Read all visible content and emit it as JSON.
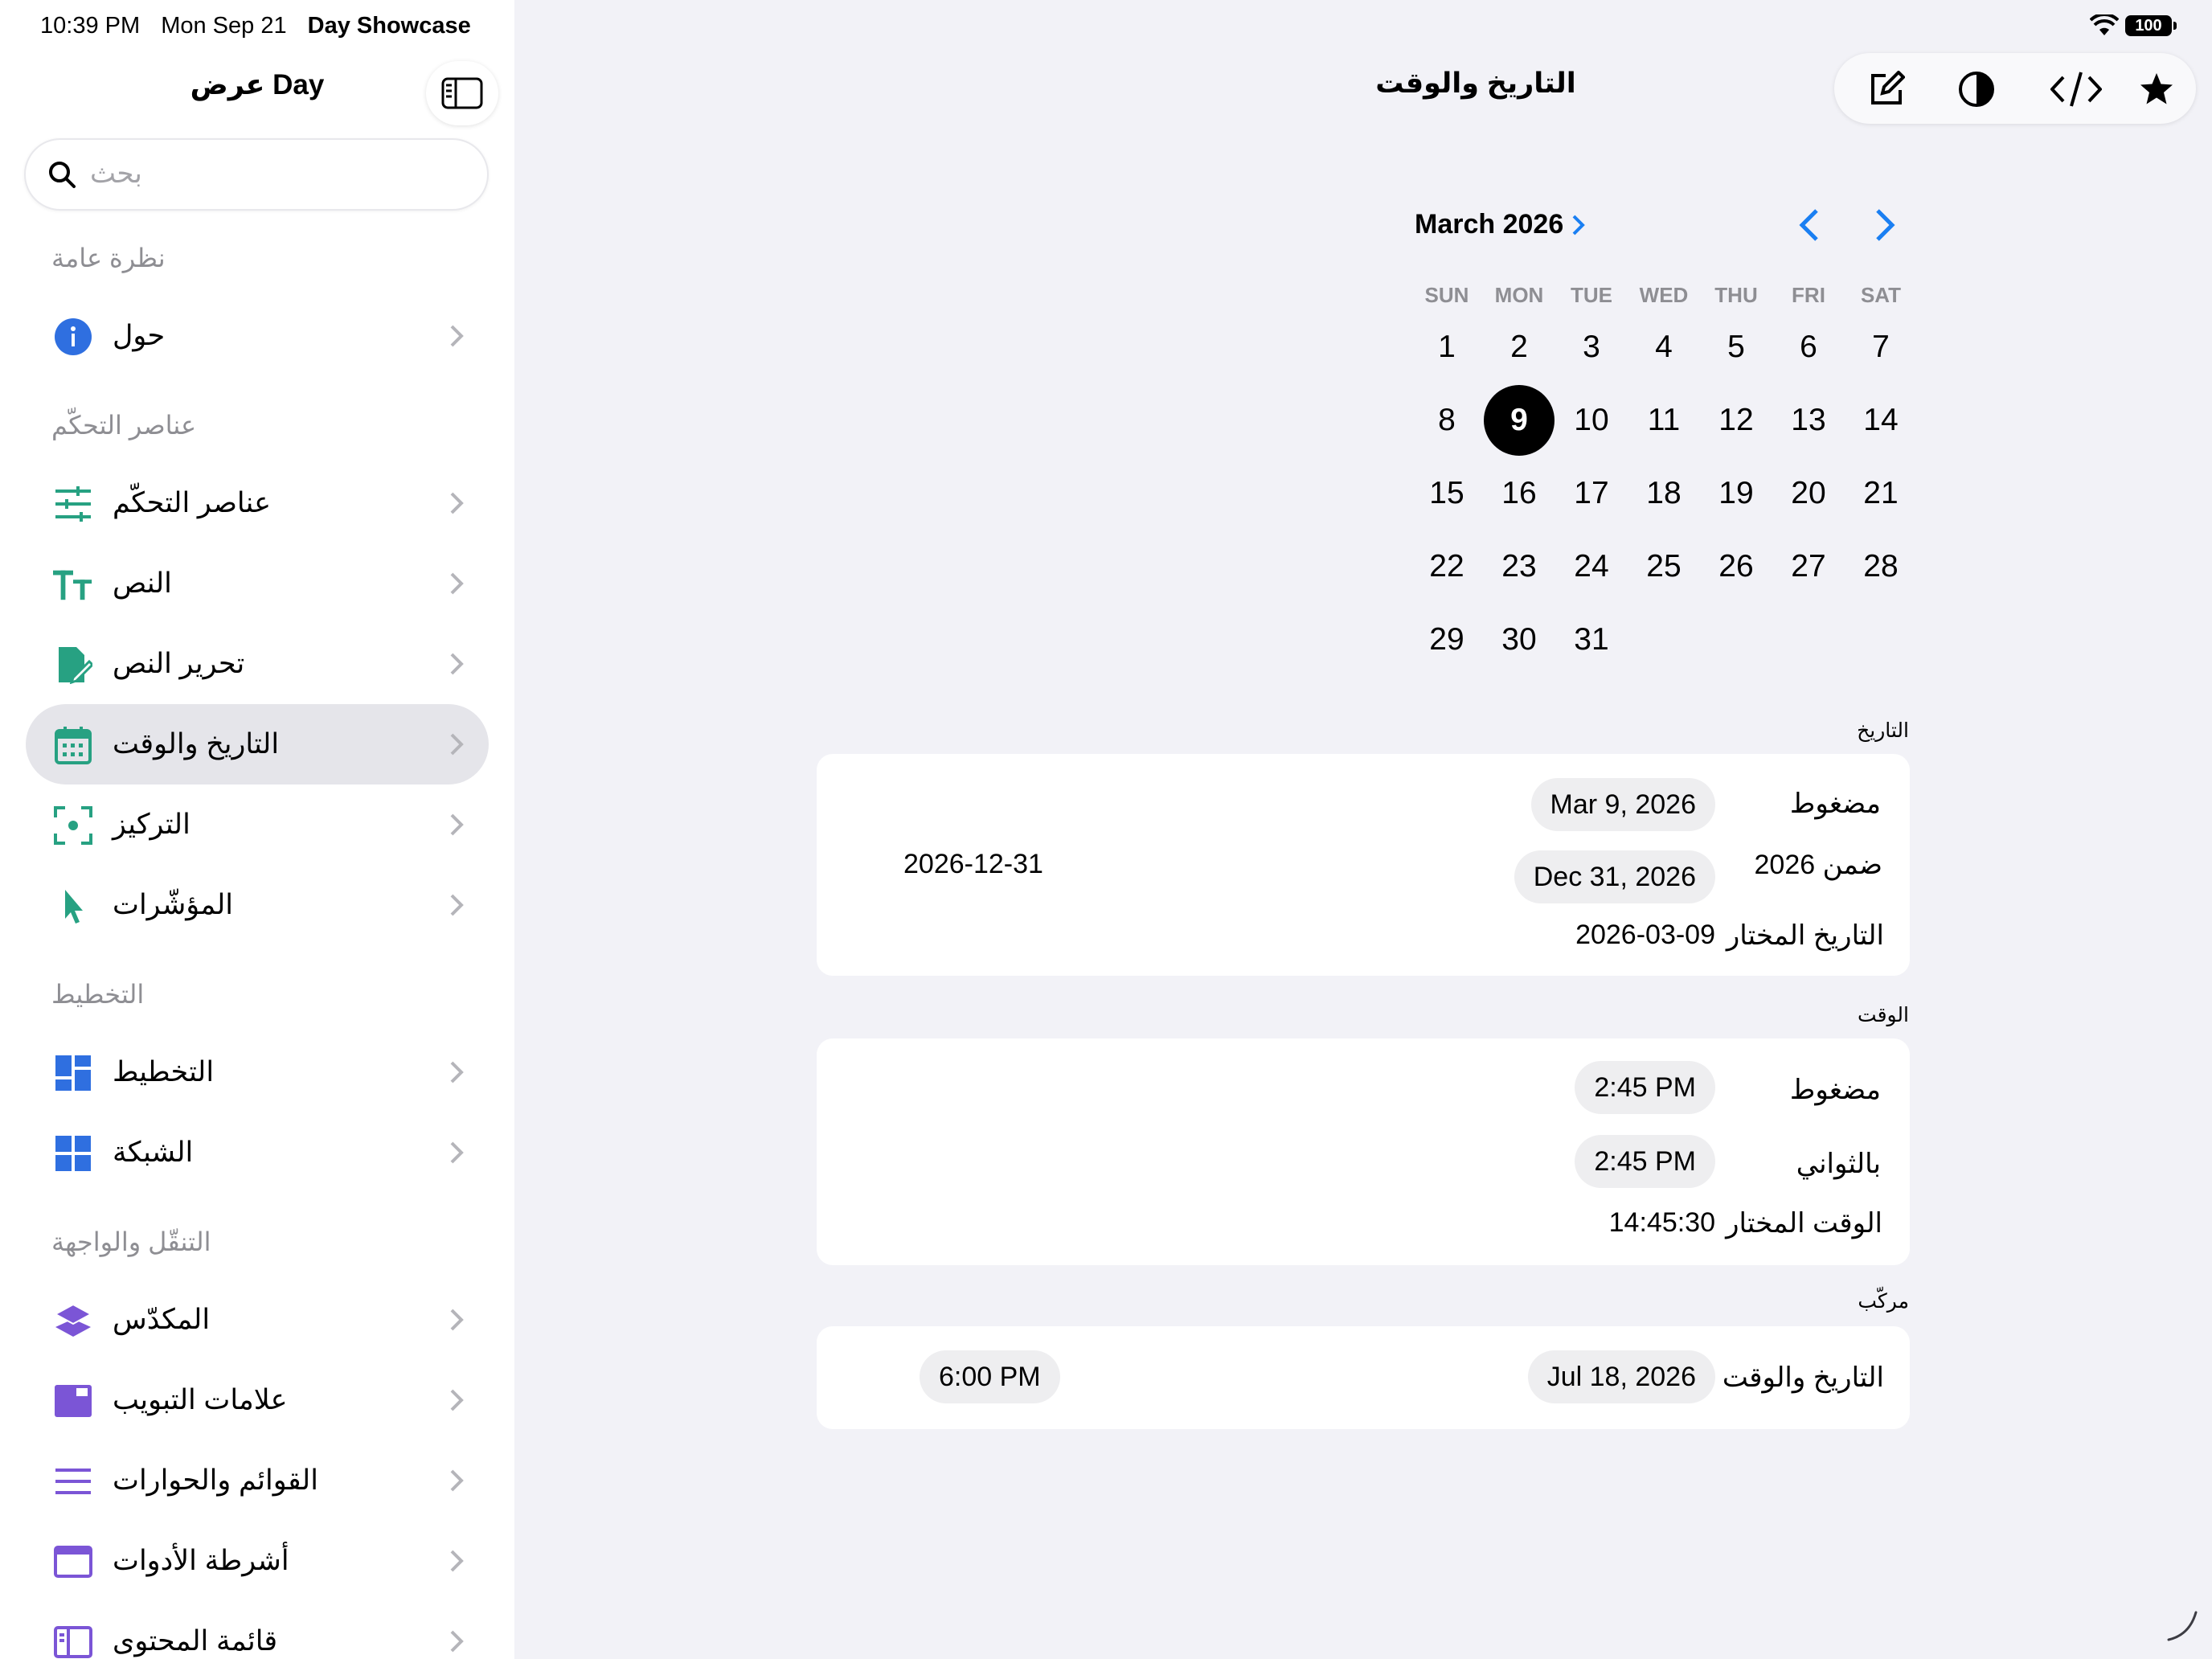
{
  "status": {
    "time": "10:39 PM",
    "date": "Mon Sep 21",
    "app": "Day Showcase",
    "battery": "100"
  },
  "sidebar": {
    "title": "عرض Day",
    "search_placeholder": "بحث",
    "sections": {
      "overview": "نظرة عامة",
      "controls": "عناصر التحكّم",
      "layout": "التخطيط",
      "navigation": "التنقّل والواجهة"
    },
    "items": [
      {
        "label": "حول",
        "icon": "info-icon"
      },
      {
        "label": "عناصر التحكّم",
        "icon": "sliders-icon"
      },
      {
        "label": "النص",
        "icon": "text-format-icon"
      },
      {
        "label": "تحرير النص",
        "icon": "doc-edit-icon"
      },
      {
        "label": "التاريخ والوقت",
        "icon": "calendar-icon"
      },
      {
        "label": "التركيز",
        "icon": "focus-icon"
      },
      {
        "label": "المؤشّرات",
        "icon": "pointer-icon"
      },
      {
        "label": "التخطيط",
        "icon": "layout-icon"
      },
      {
        "label": "الشبكة",
        "icon": "grid-icon"
      },
      {
        "label": "المكدّس",
        "icon": "stack-icon"
      },
      {
        "label": "علامات التبويب",
        "icon": "tabs-icon"
      },
      {
        "label": "القوائم والحوارات",
        "icon": "list-icon"
      },
      {
        "label": "أشرطة الأدوات",
        "icon": "toolbar-icon"
      },
      {
        "label": "قائمة المحتوى",
        "icon": "sidebar-list-icon"
      }
    ],
    "selected_item": "التاريخ والوقت"
  },
  "main": {
    "title": "التاريخ والوقت",
    "toolbar": [
      "edit-icon",
      "contrast-icon",
      "code-icon",
      "star-icon"
    ],
    "calendar": {
      "month_label": "March 2026",
      "weekdays": [
        "SUN",
        "MON",
        "TUE",
        "WED",
        "THU",
        "FRI",
        "SAT"
      ],
      "days": [
        "1",
        "2",
        "3",
        "4",
        "5",
        "6",
        "7",
        "8",
        "9",
        "10",
        "11",
        "12",
        "13",
        "14",
        "15",
        "16",
        "17",
        "18",
        "19",
        "20",
        "21",
        "22",
        "23",
        "24",
        "25",
        "26",
        "27",
        "28",
        "29",
        "30",
        "31"
      ],
      "first_weekday_index": 0,
      "selected_day": "9"
    },
    "date_section": {
      "caption": "التاريخ",
      "compact_label": "مضغوط",
      "compact_value": "Mar 9, 2026",
      "in2026_label": "ضمن 2026",
      "in2026_value": "Dec 31, 2026",
      "in2026_text": "2026-12-31",
      "selected_label": "التاريخ المختار",
      "selected_value": "2026-03-09"
    },
    "time_section": {
      "caption": "الوقت",
      "compact_label": "مضغوط",
      "compact_value": "2:45 PM",
      "seconds_label": "بالثواني",
      "seconds_value": "2:45 PM",
      "selected_label": "الوقت المختار",
      "selected_value": "14:45:30"
    },
    "combined_section": {
      "caption": "مركّب",
      "label": "التاريخ والوقت",
      "date_value": "Jul 18, 2026",
      "time_value": "6:00 PM"
    }
  }
}
